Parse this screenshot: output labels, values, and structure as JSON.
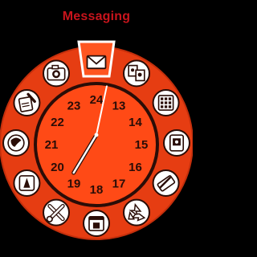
{
  "header": {
    "title": "Messaging"
  },
  "colors": {
    "background": "#000000",
    "title": "#c8141c",
    "outer_ring": "#e63d12",
    "face": "#ff4a16",
    "ink": "#2a0d07",
    "hands": "#ffffff",
    "selected_tile": "#ffffff"
  },
  "menu": {
    "selected": "messaging",
    "items": [
      {
        "id": "messaging",
        "icon": "envelope-icon"
      },
      {
        "id": "media",
        "icon": "picture-frames-icon"
      },
      {
        "id": "organizer",
        "icon": "calculator-grid-icon"
      },
      {
        "id": "apps",
        "icon": "mobile-screen-icon"
      },
      {
        "id": "connectivity",
        "icon": "card-swipe-icon"
      },
      {
        "id": "extras",
        "icon": "recycle-icon"
      },
      {
        "id": "calendar",
        "icon": "calendar-icon"
      },
      {
        "id": "tools",
        "icon": "wrench-screwdriver-icon"
      },
      {
        "id": "play",
        "icon": "play-triangle-icon"
      },
      {
        "id": "web",
        "icon": "web-globe-icon"
      },
      {
        "id": "notes",
        "icon": "notepad-pen-icon"
      },
      {
        "id": "camera",
        "icon": "camera-icon"
      }
    ]
  },
  "clock": {
    "hour_labels": [
      "24",
      "13",
      "14",
      "15",
      "16",
      "17",
      "18",
      "19",
      "20",
      "21",
      "22",
      "23"
    ],
    "time": {
      "hour": 19,
      "minute": 2
    }
  }
}
